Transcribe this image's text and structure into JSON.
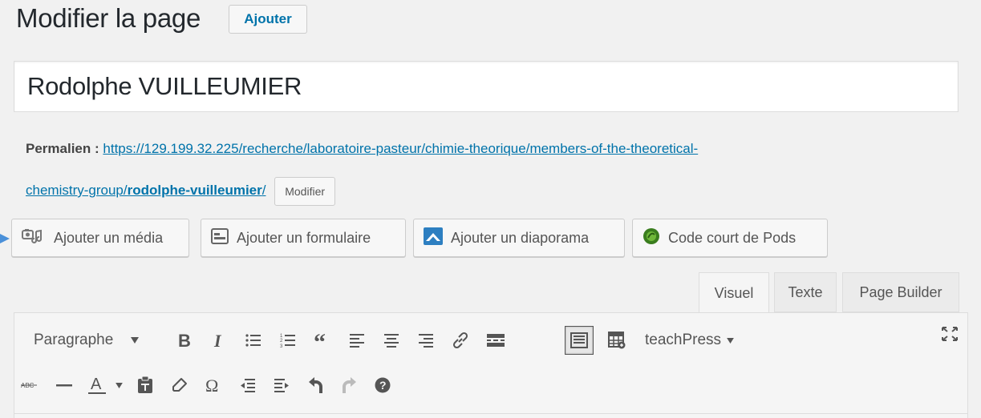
{
  "header": {
    "title": "Modifier la page",
    "add_button": "Ajouter"
  },
  "post_title": {
    "value": "Rodolphe VUILLEUMIER"
  },
  "permalink": {
    "label": "Permalien :",
    "url_part1": "https://129.199.32.225/recherche/laboratoire-pasteur/chimie-theorique/members-of-the-theoretical-",
    "url_part2": "chemistry-group/",
    "slug": "rodolphe-vuilleumier",
    "url_end": "/",
    "edit_button": "Modifier"
  },
  "media_buttons": [
    {
      "label": "Ajouter un média",
      "icon": "media-icon"
    },
    {
      "label": "Ajouter un formulaire",
      "icon": "form-icon"
    },
    {
      "label": "Ajouter un diaporama",
      "icon": "slideshow-icon"
    },
    {
      "label": "Code court de Pods",
      "icon": "pods-icon"
    }
  ],
  "editor_tabs": [
    {
      "label": "Visuel",
      "active": true
    },
    {
      "label": "Texte",
      "active": false
    },
    {
      "label": "Page Builder",
      "active": false
    }
  ],
  "toolbar": {
    "format_select": "Paragraphe",
    "teachpress": "teachPress",
    "row1_icons": [
      "bold-icon",
      "italic-icon",
      "bullet-list-icon",
      "numbered-list-icon",
      "blockquote-icon",
      "align-left-icon",
      "align-center-icon",
      "align-right-icon",
      "link-icon",
      "read-more-icon",
      "toolbar-toggle-icon",
      "table-icon",
      "fullscreen-icon"
    ],
    "row2_icons": [
      "strikethrough-icon",
      "horizontal-line-icon",
      "text-color-icon",
      "paste-text-icon",
      "clear-format-icon",
      "special-char-icon",
      "outdent-icon",
      "indent-icon",
      "undo-icon",
      "redo-icon",
      "help-icon"
    ]
  },
  "colors": {
    "link": "#0073aa",
    "background": "#f1f1f1",
    "arrow": "#4a90d9"
  }
}
